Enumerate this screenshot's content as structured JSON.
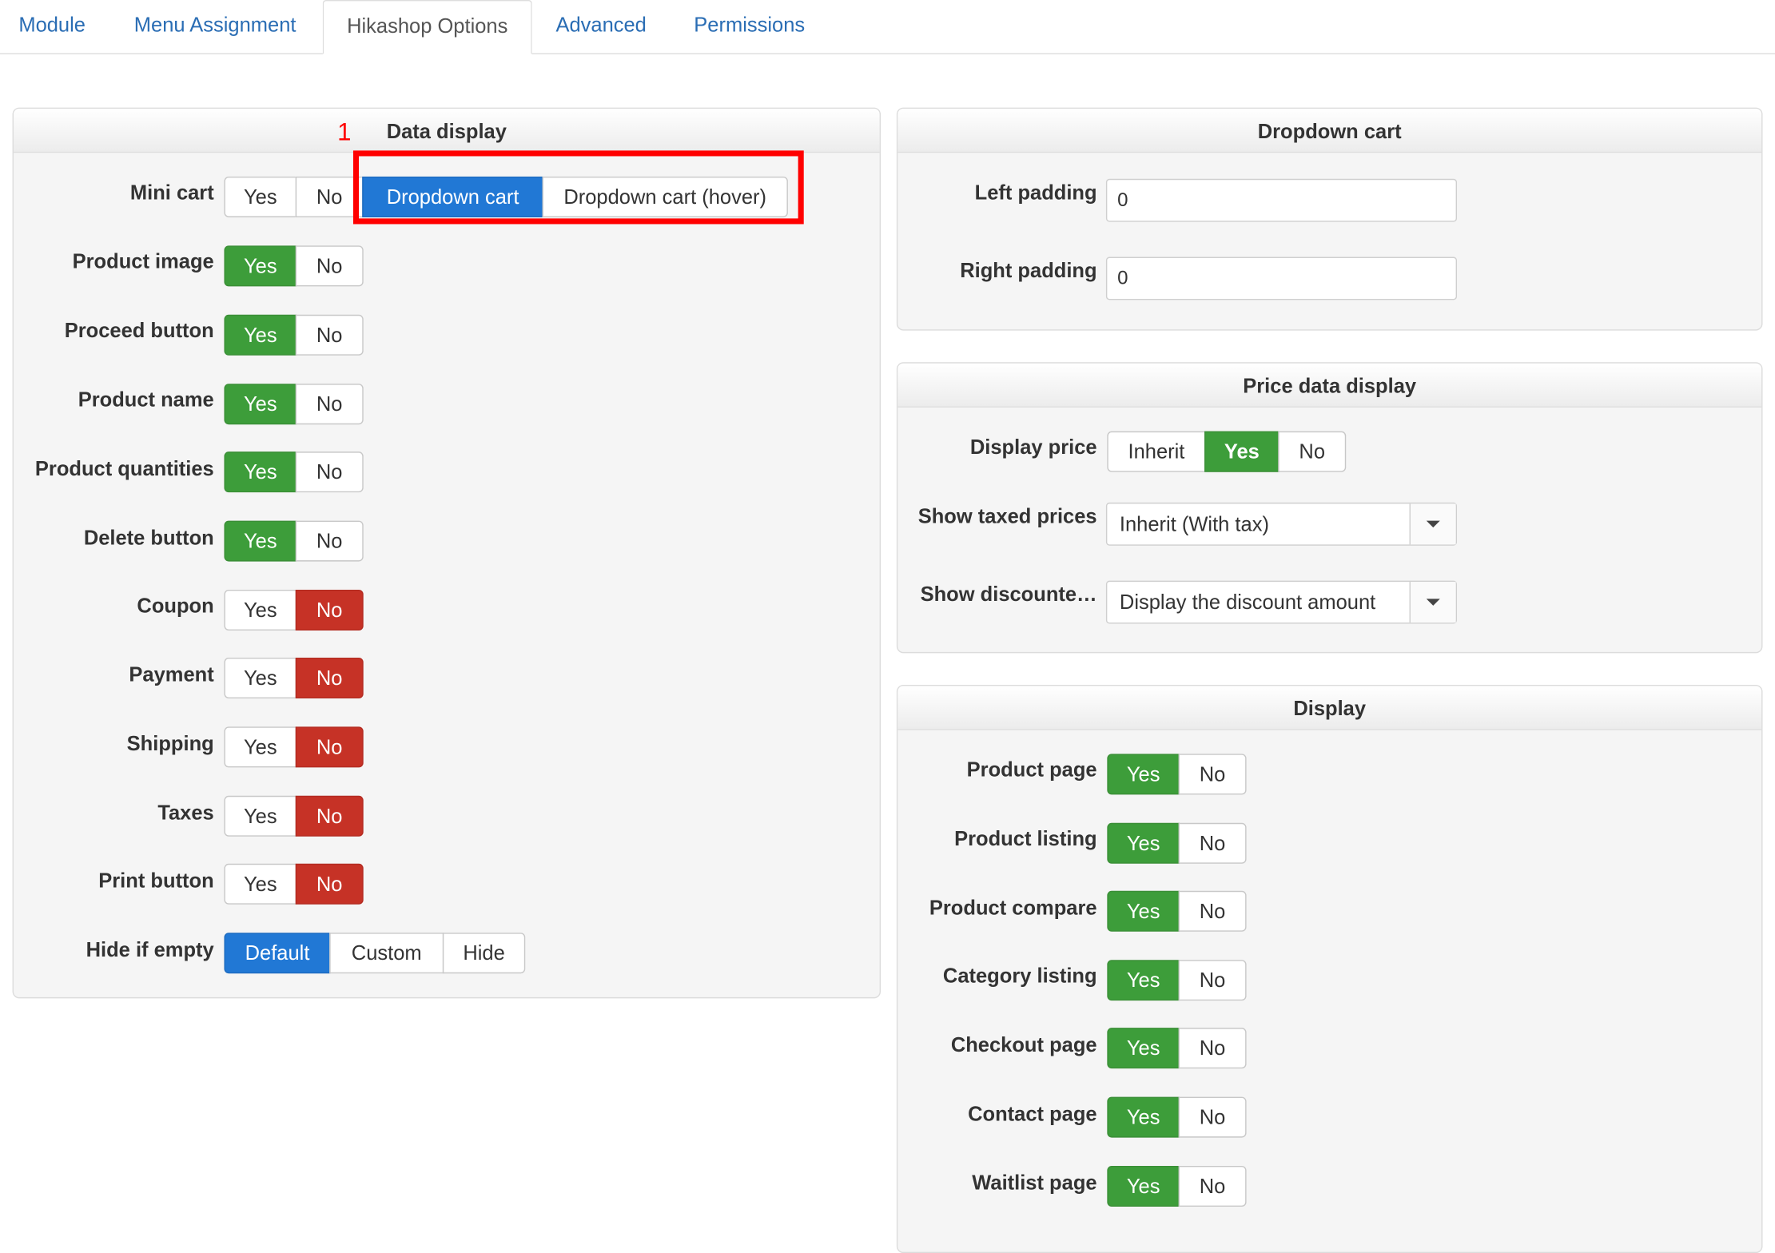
{
  "tabs": [
    {
      "label": "Module"
    },
    {
      "label": "Menu Assignment"
    },
    {
      "label": "Hikashop Options"
    },
    {
      "label": "Advanced"
    },
    {
      "label": "Permissions"
    }
  ],
  "active_tab": "Hikashop Options",
  "annotation": {
    "number": "1"
  },
  "data_display": {
    "title": "Data display",
    "mini_cart": {
      "label": "Mini cart",
      "options": [
        "Yes",
        "No",
        "Dropdown cart",
        "Dropdown cart (hover)"
      ],
      "selected": "Dropdown cart"
    },
    "rows": [
      {
        "label": "Product image",
        "yes": "Yes",
        "no": "No",
        "selected": "Yes"
      },
      {
        "label": "Proceed button",
        "yes": "Yes",
        "no": "No",
        "selected": "Yes"
      },
      {
        "label": "Product name",
        "yes": "Yes",
        "no": "No",
        "selected": "Yes"
      },
      {
        "label": "Product quantities",
        "yes": "Yes",
        "no": "No",
        "selected": "Yes"
      },
      {
        "label": "Delete button",
        "yes": "Yes",
        "no": "No",
        "selected": "Yes"
      },
      {
        "label": "Coupon",
        "yes": "Yes",
        "no": "No",
        "selected": "No"
      },
      {
        "label": "Payment",
        "yes": "Yes",
        "no": "No",
        "selected": "No"
      },
      {
        "label": "Shipping",
        "yes": "Yes",
        "no": "No",
        "selected": "No"
      },
      {
        "label": "Taxes",
        "yes": "Yes",
        "no": "No",
        "selected": "No"
      },
      {
        "label": "Print button",
        "yes": "Yes",
        "no": "No",
        "selected": "No"
      }
    ],
    "hide_if_empty": {
      "label": "Hide if empty",
      "options": [
        "Default",
        "Custom",
        "Hide"
      ],
      "selected": "Default"
    }
  },
  "dropdown_cart": {
    "title": "Dropdown cart",
    "left_padding": {
      "label": "Left padding",
      "value": "0"
    },
    "right_padding": {
      "label": "Right padding",
      "value": "0"
    }
  },
  "price_data_display": {
    "title": "Price data display",
    "display_price": {
      "label": "Display price",
      "options": [
        "Inherit",
        "Yes",
        "No"
      ],
      "selected": "Yes"
    },
    "show_taxed_prices": {
      "label": "Show taxed prices",
      "value": "Inherit (With tax)"
    },
    "show_discounted": {
      "label": "Show discounte…",
      "value": "Display the discount amount"
    }
  },
  "display": {
    "title": "Display",
    "rows": [
      {
        "label": "Product page",
        "yes": "Yes",
        "no": "No",
        "selected": "Yes"
      },
      {
        "label": "Product listing",
        "yes": "Yes",
        "no": "No",
        "selected": "Yes"
      },
      {
        "label": "Product compare",
        "yes": "Yes",
        "no": "No",
        "selected": "Yes"
      },
      {
        "label": "Category listing",
        "yes": "Yes",
        "no": "No",
        "selected": "Yes"
      },
      {
        "label": "Checkout page",
        "yes": "Yes",
        "no": "No",
        "selected": "Yes"
      },
      {
        "label": "Contact page",
        "yes": "Yes",
        "no": "No",
        "selected": "Yes"
      },
      {
        "label": "Waitlist page",
        "yes": "Yes",
        "no": "No",
        "selected": "Yes"
      }
    ]
  },
  "colors": {
    "yes_active": "#3d9d3a",
    "no_active": "#c63226",
    "choice_active": "#2178d5",
    "annotation": "#ff0000",
    "tab_link": "#2a6db4"
  }
}
